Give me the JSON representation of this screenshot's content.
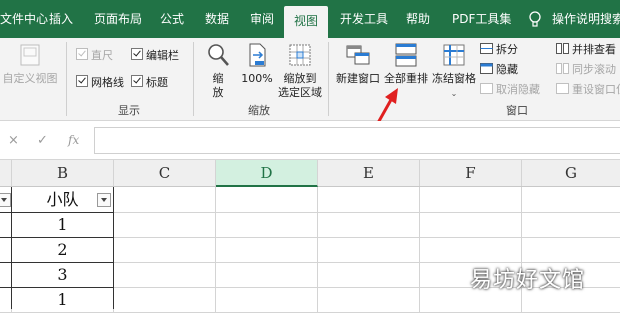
{
  "tabs": [
    "文件中心",
    "插入",
    "页面布局",
    "公式",
    "数据",
    "审阅",
    "视图",
    "开发工具",
    "帮助",
    "PDF工具集",
    "操作说明搜索"
  ],
  "ribbon": {
    "custom_view": "自定义视图",
    "show_group": {
      "ruler": "直尺",
      "formula_bar": "编辑栏",
      "gridlines": "网格线",
      "headings": "标题",
      "label": "显示"
    },
    "zoom_group": {
      "zoom": "缩放",
      "hundred": "100%",
      "zoom_to_selection_line1": "缩放到",
      "zoom_to_selection_line2": "选定区域",
      "label": "缩放"
    },
    "window_group": {
      "new_window": "新建窗口",
      "arrange_all": "全部重排",
      "freeze_panes": "冻结窗格",
      "split": "拆分",
      "hide": "隐藏",
      "unhide": "取消隐藏",
      "side_by_side": "并排查看",
      "sync_scroll": "同步滚动",
      "reset_position": "重设窗口位置",
      "label": "窗口"
    }
  },
  "formula_bar": {
    "cancel": "×",
    "enter": "✓",
    "fx": "fx",
    "value": ""
  },
  "sheet": {
    "columns": [
      "B",
      "C",
      "D",
      "E",
      "F",
      "G"
    ],
    "selected_column": "D",
    "header_cell": "小队",
    "values": [
      "1",
      "2",
      "3",
      "1"
    ]
  },
  "watermark": "易坊好文馆",
  "colors": {
    "accent": "#217346",
    "arrow": "#e02020"
  }
}
